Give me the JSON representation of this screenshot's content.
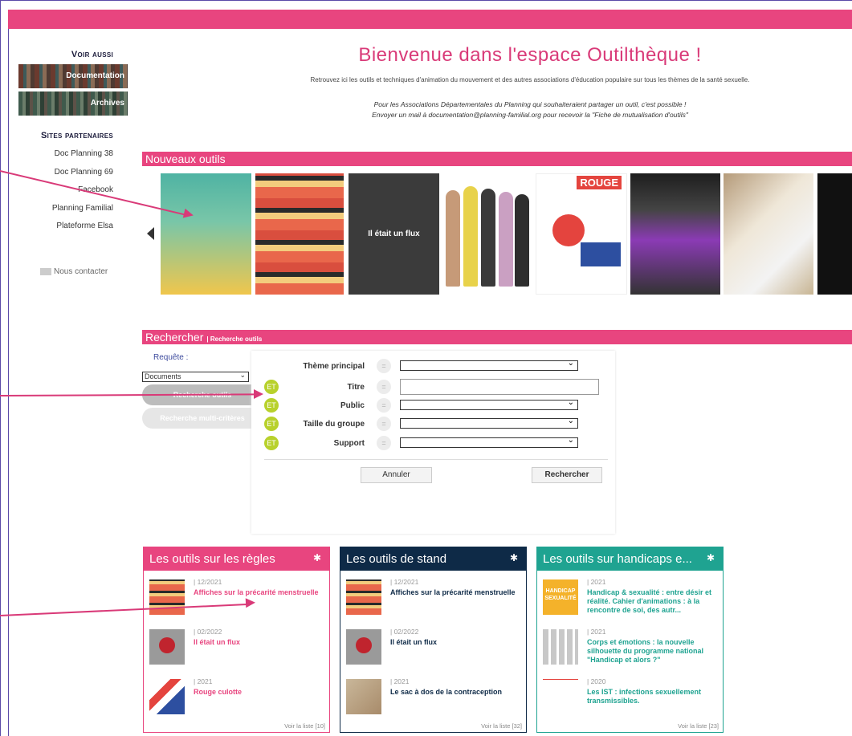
{
  "sidebar": {
    "voir_aussi": "Voir aussi",
    "doc_btn": "Documentation",
    "archives_btn": "Archives",
    "sites_title": "Sites partenaires",
    "links": [
      "Doc Planning 38",
      "Doc Planning 69",
      "Facebook",
      "Planning Familial",
      "Plateforme Elsa"
    ],
    "contact": "Nous contacter"
  },
  "header": {
    "title": "Bienvenue dans l'espace Outilthèque !",
    "intro": "Retrouvez ici les outils et techniques d'animation du mouvement et des autres associations d'éducation populaire sur tous les thèmes de la santé sexuelle.",
    "share_line1": "Pour les Associations Départementales du Planning qui souhaiteraient partager un outil, c'est possible !",
    "share_line2": "Envoyer un mail à documentation@planning-familial.org pour recevoir la \"Fiche de mutualisation d'outils\""
  },
  "nouveaux": {
    "title": "Nouveaux outils",
    "tile3_label": "Il était un flux",
    "tile5_label": "ROUGE"
  },
  "recherche": {
    "title": "Rechercher",
    "subtitle": "| Recherche outils",
    "requete": "Requête :",
    "docs_select": "Documents",
    "btn_outils": "Recherche outils",
    "btn_multi": "Recherche multi-critères",
    "rows": [
      {
        "et": "",
        "label": "Thème principal",
        "eq": "="
      },
      {
        "et": "ET",
        "label": "Titre",
        "eq": "="
      },
      {
        "et": "ET",
        "label": "Public",
        "eq": "="
      },
      {
        "et": "ET",
        "label": "Taille du groupe",
        "eq": "="
      },
      {
        "et": "ET",
        "label": "Support",
        "eq": "="
      }
    ],
    "annuler": "Annuler",
    "rechercher": "Rechercher"
  },
  "cards": [
    {
      "title": "Les outils sur les règles",
      "more": "Voir la liste [10]",
      "items": [
        {
          "date": "| 12/2021",
          "title": "Affiches sur la précarité menstruelle"
        },
        {
          "date": "| 02/2022",
          "title": "Il était un flux"
        },
        {
          "date": "| 2021",
          "title": "Rouge culotte"
        }
      ]
    },
    {
      "title": "Les outils de stand",
      "more": "Voir la liste [32]",
      "items": [
        {
          "date": "| 12/2021",
          "title": "Affiches sur la précarité menstruelle"
        },
        {
          "date": "| 02/2022",
          "title": "Il était un flux"
        },
        {
          "date": "| 2021",
          "title": "Le sac à dos de la contraception"
        }
      ]
    },
    {
      "title": "Les outils sur handicaps e...",
      "more": "Voir la liste [23]",
      "items": [
        {
          "date": "| 2021",
          "title": "Handicap & sexualité : entre désir et réalité. Cahier d'animations : à la rencontre de soi, des autr..."
        },
        {
          "date": "| 2021",
          "title": "Corps et émotions : la nouvelle silhouette du programme national \"Handicap et alors ?\""
        },
        {
          "date": "| 2020",
          "title": "Les IST : infections sexuellement transmissibles."
        }
      ]
    }
  ],
  "thumb_labels": {
    "handicap": "HANDICAP SEXUALITÉ"
  }
}
